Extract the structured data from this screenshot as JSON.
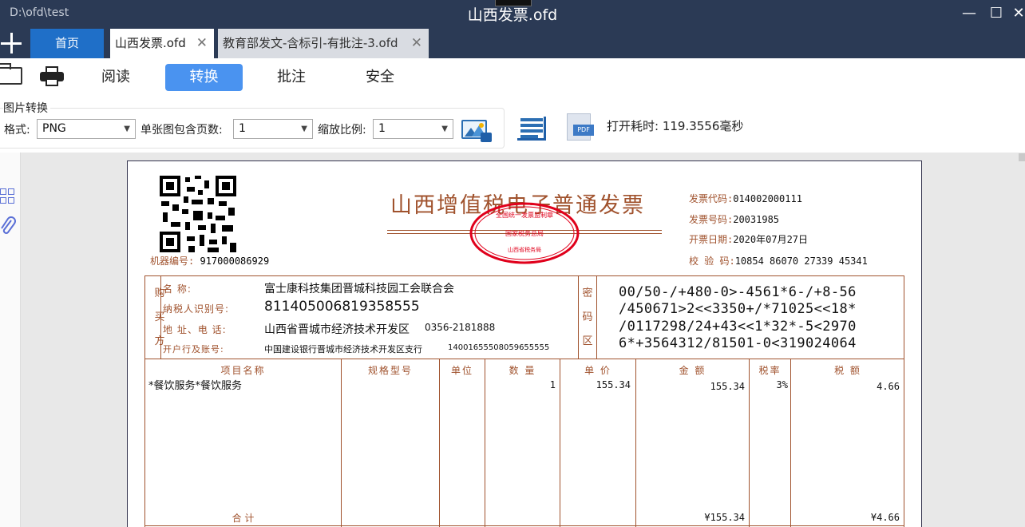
{
  "window": {
    "path": "D:\\ofd\\test",
    "title": "山西发票.ofd",
    "minimize": "—",
    "maximize": "☐",
    "close": "✕"
  },
  "tabs": {
    "home": "首页",
    "active": "山西发票.ofd",
    "other": "教育部发文-含标引-有批注-3.ofd",
    "close_glyph": "✕"
  },
  "menu": {
    "read": "阅读",
    "convert": "转换",
    "annotate": "批注",
    "security": "安全"
  },
  "image_convert": {
    "group_label": "图片转换",
    "format_label": "格式:",
    "format_value": "PNG",
    "pages_label": "单张图包含页数:",
    "pages_value": "1",
    "scale_label": "缩放比例:",
    "scale_value": "1",
    "timing": "打开耗时: 119.3556毫秒"
  },
  "icons": {
    "accent": "#4a93f0",
    "titlebar": "#2b3a55",
    "invoice_brown": "#a0522d",
    "stamp_red": "#e0001b"
  },
  "invoice": {
    "title": "山西增值税电子普通发票",
    "stamp_top": "全国统一发票监制章",
    "stamp_mid": "国家税务总局",
    "stamp_bottom": "山西省税务局",
    "machine_label": "机器编号:",
    "machine_no": "917000086929",
    "code_label": "发票代码:",
    "code": "014002000111",
    "number_label": "发票号码:",
    "number": "20031985",
    "date_label": "开票日期:",
    "date": "2020年07月27日",
    "check_label": "校 验 码:",
    "check": "10854 86070 27339 45341",
    "buyer_side": [
      "购",
      "买",
      "方"
    ],
    "cipher_side": [
      "密",
      "码",
      "区"
    ],
    "buyer": {
      "name_label": "名        称:",
      "name": "富士康科技集团晋城科技园工会联合会",
      "tax_label": "纳税人识别号:",
      "tax_id": "811405006819358555",
      "addr_label": "地 址、电 话:",
      "addr": "山西省晋城市经济技术开发区",
      "phone": "0356-2181888",
      "bank_label": "开户行及账号:",
      "bank": "中国建设银行晋城市经济技术开发区支行",
      "account": "14001655508059655555"
    },
    "cipher": [
      "00/50-/+480-0>-4561*6-/+8-56",
      "/450671>2<<3350+/*71025<<18*",
      "/0117298/24+43<<1*32*-5<2970",
      "6*+3564312/81501-0<319024064"
    ],
    "columns": [
      "项目名称",
      "规格型号",
      "单位",
      "数 量",
      "单 价",
      "金 额",
      "税率",
      "税 额"
    ],
    "item": {
      "name": "*餐饮服务*餐饮服务",
      "qty": "1",
      "price": "155.34",
      "amount": "155.34",
      "rate": "3%",
      "tax": "4.66"
    },
    "total_label": "合      计",
    "total_amount": "¥155.34",
    "total_tax": "¥4.66"
  }
}
